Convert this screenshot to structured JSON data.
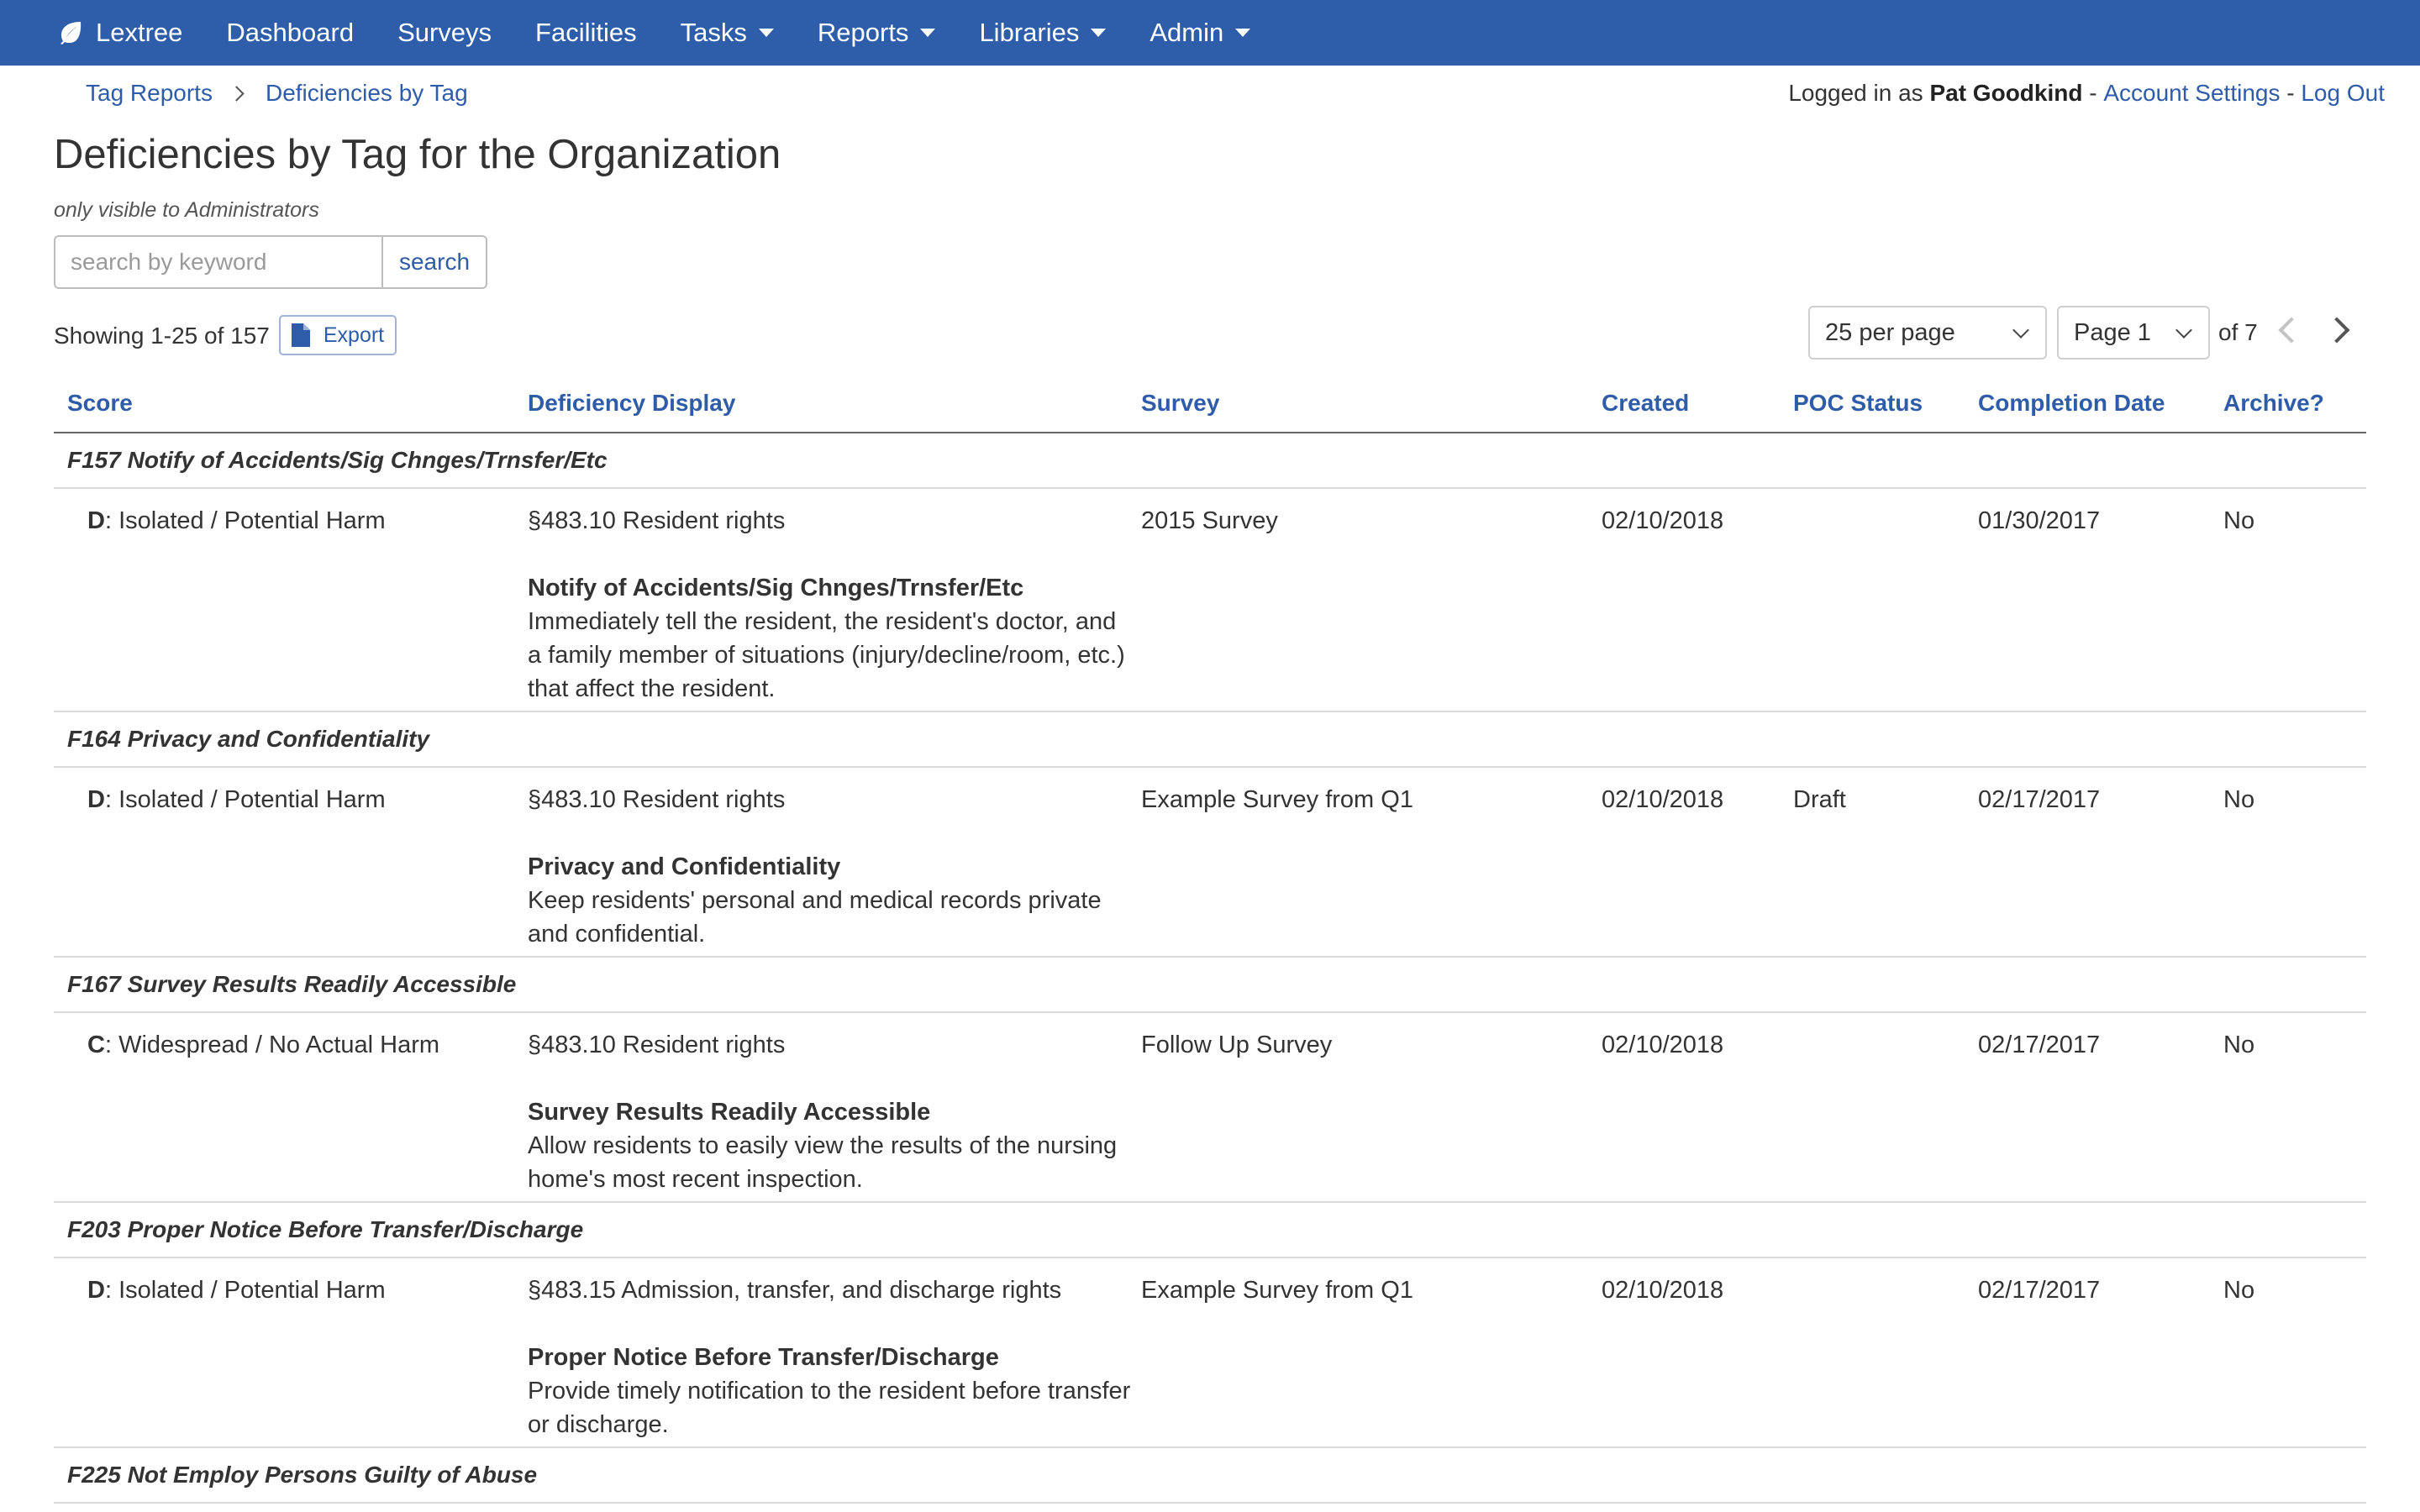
{
  "nav": {
    "brand": "Lextree",
    "items": [
      {
        "label": "Dashboard",
        "dropdown": false
      },
      {
        "label": "Surveys",
        "dropdown": false
      },
      {
        "label": "Facilities",
        "dropdown": false
      },
      {
        "label": "Tasks",
        "dropdown": true
      },
      {
        "label": "Reports",
        "dropdown": true
      },
      {
        "label": "Libraries",
        "dropdown": true
      },
      {
        "label": "Admin",
        "dropdown": true
      }
    ],
    "bar_color": "#2e5da9"
  },
  "breadcrumb": [
    "Tag Reports",
    "Deficiencies by Tag"
  ],
  "user": {
    "prefix": "Logged in as ",
    "name": "Pat Goodkind",
    "sep": " - ",
    "account_settings": "Account Settings",
    "logout": "Log Out"
  },
  "page": {
    "title": "Deficiencies by Tag for the Organization",
    "note": "only visible to Administrators"
  },
  "search": {
    "placeholder": "search by keyword",
    "value": "",
    "button": "search"
  },
  "toolbar": {
    "showing": "Showing 1-25 of 157",
    "export": "Export",
    "per_page": "25 per page",
    "page": "Page 1",
    "of_total": "of 7"
  },
  "columns": {
    "score": "Score",
    "deficiency": "Deficiency Display",
    "survey": "Survey",
    "created": "Created",
    "poc": "POC Status",
    "completion": "Completion Date",
    "archive": "Archive?"
  },
  "groups": [
    {
      "label": "F157 Notify of Accidents/Sig Chnges/Trnsfer/Etc",
      "row": {
        "score_code": "D",
        "score_text": ": Isolated / Potential Harm",
        "section": "§483.10 Resident rights",
        "title": "Notify of Accidents/Sig Chnges/Trnsfer/Etc",
        "text": "Immediately tell the resident, the resident's doctor, and a family member of situations (injury/decline/room, etc.) that affect the resident.",
        "survey": "2015 Survey",
        "created": "02/10/2018",
        "poc": "",
        "completion": "01/30/2017",
        "archive": "No"
      }
    },
    {
      "label": "F164 Privacy and Confidentiality",
      "row": {
        "score_code": "D",
        "score_text": ": Isolated / Potential Harm",
        "section": "§483.10 Resident rights",
        "title": "Privacy and Confidentiality",
        "text": "Keep residents' personal and medical records private and confidential.",
        "survey": "Example Survey from Q1",
        "created": "02/10/2018",
        "poc": "Draft",
        "completion": "02/17/2017",
        "archive": "No"
      }
    },
    {
      "label": "F167 Survey Results Readily Accessible",
      "row": {
        "score_code": "C",
        "score_text": ": Widespread / No Actual Harm",
        "section": "§483.10 Resident rights",
        "title": "Survey Results Readily Accessible",
        "text": "Allow residents to easily view the results of the nursing home's most recent inspection.",
        "survey": "Follow Up Survey",
        "created": "02/10/2018",
        "poc": "",
        "completion": "02/17/2017",
        "archive": "No"
      }
    },
    {
      "label": "F203 Proper Notice Before Transfer/Discharge",
      "row": {
        "score_code": "D",
        "score_text": ": Isolated / Potential Harm",
        "section": "§483.15 Admission, transfer, and discharge rights",
        "title": "Proper Notice Before Transfer/Discharge",
        "text": "Provide timely notification to the resident before transfer or discharge.",
        "survey": "Example Survey from Q1",
        "created": "02/10/2018",
        "poc": "",
        "completion": "02/17/2017",
        "archive": "No"
      }
    },
    {
      "label": "F225 Not Employ Persons Guilty of Abuse"
    }
  ]
}
